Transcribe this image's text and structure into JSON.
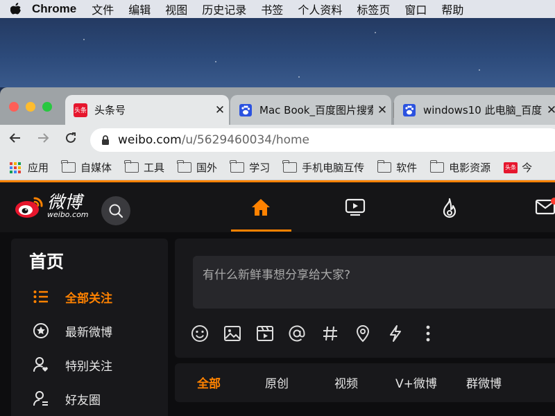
{
  "menubar": {
    "app_name": "Chrome",
    "items": [
      "文件",
      "编辑",
      "视图",
      "历史记录",
      "书签",
      "个人资料",
      "标签页",
      "窗口",
      "帮助"
    ]
  },
  "browser": {
    "tabs": [
      {
        "title": "头条号",
        "favicon": "toutiao-icon",
        "favicon_text": "头条",
        "active": true
      },
      {
        "title": "Mac Book_百度图片搜索",
        "favicon": "baidu-paw-icon",
        "active": false
      },
      {
        "title": "windows10 此电脑_百度",
        "favicon": "baidu-paw-icon",
        "active": false
      }
    ],
    "address": {
      "host": "weibo.com",
      "path": "/u/5629460034/home"
    },
    "bookmarks": [
      {
        "label": "应用",
        "icon": "apps-grid-icon"
      },
      {
        "label": "自媒体",
        "icon": "folder-icon"
      },
      {
        "label": "工具",
        "icon": "folder-icon"
      },
      {
        "label": "国外",
        "icon": "folder-icon"
      },
      {
        "label": "学习",
        "icon": "folder-icon"
      },
      {
        "label": "手机电脑互传",
        "icon": "folder-icon"
      },
      {
        "label": "软件",
        "icon": "folder-icon"
      },
      {
        "label": "电影资源",
        "icon": "folder-icon"
      },
      {
        "label": "今",
        "icon": "toutiao-icon",
        "icon_text": "头条"
      }
    ]
  },
  "weibo": {
    "logo_text": "微博",
    "logo_sub": "weibo.com",
    "nav_icons": [
      "home-icon",
      "video-icon",
      "hot-flame-icon",
      "mail-icon"
    ],
    "sidebar": {
      "title": "首页",
      "items": [
        {
          "label": "全部关注",
          "icon": "list-icon",
          "active": true
        },
        {
          "label": "最新微博",
          "icon": "star-circle-icon",
          "active": false
        },
        {
          "label": "特别关注",
          "icon": "user-heart-icon",
          "active": false
        },
        {
          "label": "好友圈",
          "icon": "user-group-icon",
          "active": false
        }
      ]
    },
    "composer": {
      "placeholder": "有什么新鲜事想分享给大家?",
      "tools": [
        "emoji-icon",
        "image-icon",
        "video-icon",
        "mention-icon",
        "topic-icon",
        "location-icon",
        "lightning-icon",
        "more-icon"
      ]
    },
    "filters": [
      {
        "label": "全部",
        "active": true
      },
      {
        "label": "原创",
        "active": false
      },
      {
        "label": "视频",
        "active": false
      },
      {
        "label": "V+微博",
        "active": false
      },
      {
        "label": "群微博",
        "active": false
      }
    ]
  },
  "colors": {
    "accent": "#ff8200",
    "weibo_red": "#e6162d",
    "page_bg": "#0d0d0f"
  }
}
